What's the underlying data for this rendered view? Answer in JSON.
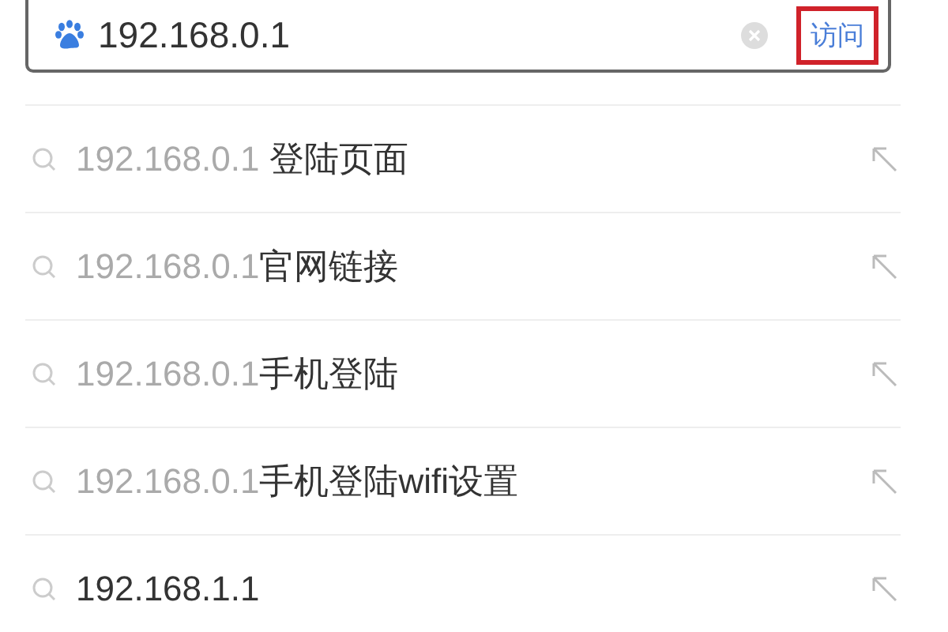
{
  "search": {
    "value": "192.168.0.1",
    "button": "访问"
  },
  "suggestions": [
    {
      "prefix": "192.168.0.1 ",
      "rest": "登陆页面"
    },
    {
      "prefix": "192.168.0.1",
      "rest": "官网链接"
    },
    {
      "prefix": "192.168.0.1",
      "rest": "手机登陆"
    },
    {
      "prefix": "192.168.0.1",
      "rest": "手机登陆wifi设置"
    },
    {
      "rest": "192.168.1.1"
    }
  ]
}
